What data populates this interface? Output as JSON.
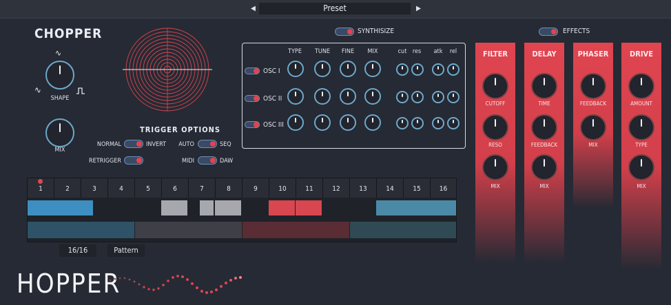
{
  "topbar": {
    "prev_icon": "triangle-left",
    "next_icon": "triangle-right",
    "preset_label": "Preset"
  },
  "chopper": {
    "title": "CHOPPER",
    "shape_label": "SHAPE",
    "mix_label": "MIX",
    "wave_icons": [
      "sine-wave-icon",
      "triangle-wave-icon",
      "square-wave-icon"
    ]
  },
  "trigger": {
    "title": "TRIGGER OPTIONS",
    "normal": "NORMAL",
    "invert": "INVERT",
    "auto": "AUTO",
    "seq": "SEQ",
    "retrigger": "RETRIGGER",
    "midi": "MIDI",
    "daw": "DAW"
  },
  "synth": {
    "toggle_label": "SYNTHISIZE",
    "columns": [
      "TYPE",
      "TUNE",
      "FINE",
      "MIX",
      "cut",
      "res",
      "atk",
      "rel"
    ],
    "oscillators": [
      "OSC I",
      "OSC II",
      "OSC III"
    ]
  },
  "effects": {
    "toggle_label": "EFFECTS",
    "filter": {
      "title": "FILTER",
      "labels": [
        "CUTOFF",
        "RESO",
        "MIX"
      ]
    },
    "delay": {
      "title": "DELAY",
      "labels": [
        "TIME",
        "FEEDBACK",
        "MIX"
      ]
    },
    "phaser": {
      "title": "PHASER",
      "labels": [
        "FEEDBACK",
        "MIX"
      ]
    },
    "drive": {
      "title": "DRIVE",
      "labels": [
        "AMOUNT",
        "TYPE",
        "MIX"
      ]
    }
  },
  "sequencer": {
    "steps": [
      "1",
      "2",
      "3",
      "4",
      "5",
      "6",
      "7",
      "8",
      "9",
      "10",
      "11",
      "12",
      "13",
      "14",
      "15",
      "16"
    ],
    "active_step": "1",
    "length_label": "16/16",
    "mode_label": "Pattern"
  },
  "brand": {
    "logo": "HOPPER"
  },
  "colors": {
    "accent_red": "#e04550",
    "accent_blue": "#6fa9cc",
    "background": "#262a34"
  }
}
